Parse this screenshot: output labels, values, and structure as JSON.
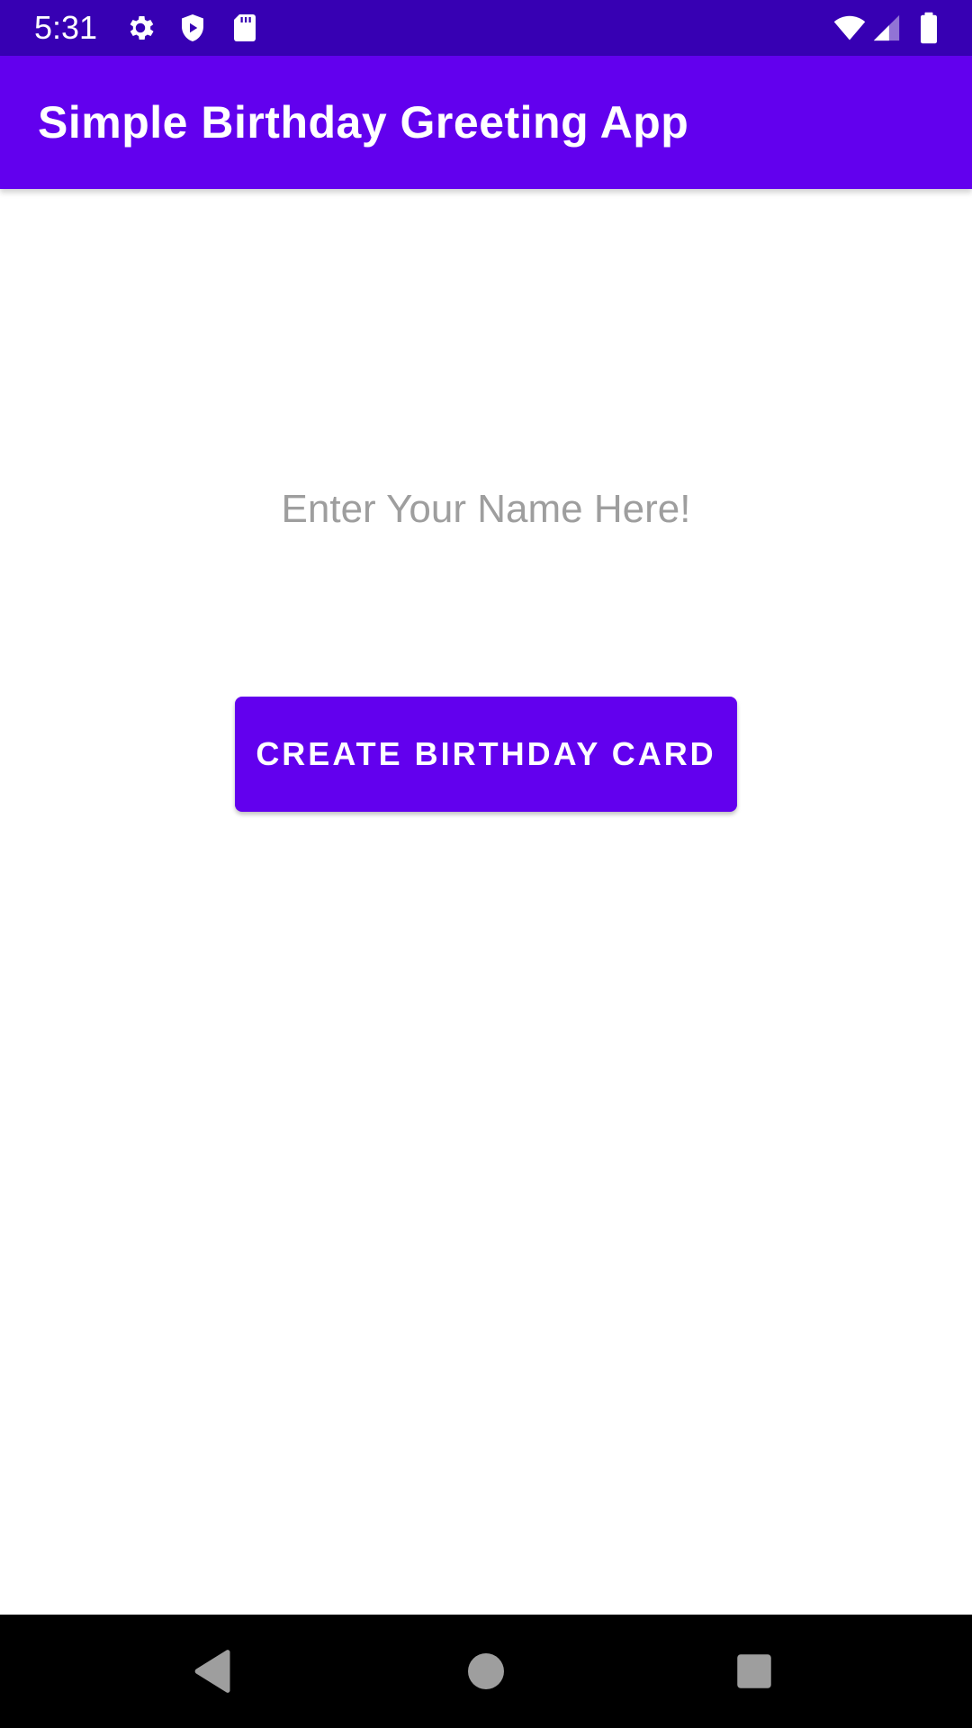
{
  "status_bar": {
    "time": "5:31",
    "left_icons": [
      "gear-icon",
      "shield-play-icon",
      "sd-card-icon"
    ],
    "right_icons": [
      "wifi-icon",
      "cell-signal-icon",
      "battery-icon"
    ],
    "background": "#3700b3"
  },
  "app_bar": {
    "title": "Simple Birthday Greeting App",
    "background": "#6200ee"
  },
  "main": {
    "name_input": {
      "value": "",
      "placeholder": "Enter Your Name Here!"
    },
    "create_button_label": "CREATE BIRTHDAY CARD",
    "accent": "#6200ee"
  },
  "nav_bar": {
    "buttons": [
      "back-icon",
      "home-icon",
      "recents-icon"
    ]
  }
}
